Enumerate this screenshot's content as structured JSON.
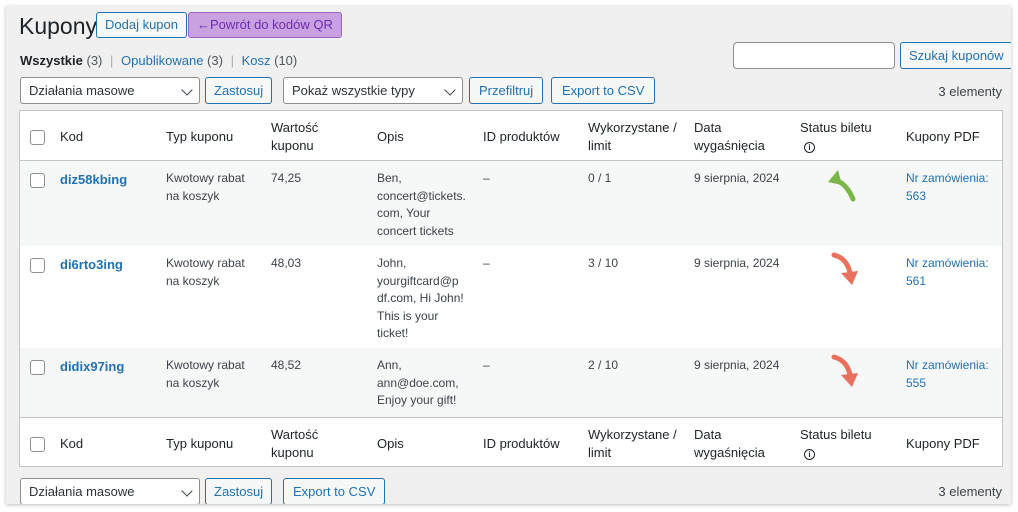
{
  "header": {
    "title": "Kupony",
    "add_button": "Dodaj kupon",
    "back_qr_button": "←Powrót do kodów QR"
  },
  "filters": {
    "all_label": "Wszystkie",
    "all_count": "(3)",
    "published_label": "Opublikowane",
    "published_count": "(3)",
    "trash_label": "Kosz",
    "trash_count": "(10)",
    "separator": "|"
  },
  "search": {
    "value": "",
    "button": "Szukaj kuponów"
  },
  "toolbar_top": {
    "bulk_actions": "Działania masowe",
    "apply": "Zastosuj",
    "type_filter": "Pokaż wszystkie typy",
    "filter_button": "Przefiltruj",
    "export_csv": "Export to CSV",
    "items_count": "3 elementy"
  },
  "toolbar_bottom": {
    "bulk_actions": "Działania masowe",
    "apply": "Zastosuj",
    "export_csv": "Export to CSV",
    "items_count": "3 elementy"
  },
  "columns": {
    "code": "Kod",
    "type": "Typ kuponu",
    "value_line1": "Wartość",
    "value_line2": "kuponu",
    "description": "Opis",
    "product_ids": "ID produktów",
    "usage_line1": "Wykorzystane /",
    "usage_line2": "limit",
    "expiry_line1": "Data",
    "expiry_line2": "wygaśnięcia",
    "ticket_status": "Status biletu",
    "ticket_status_icon": "info-icon",
    "pdf": "Kupony PDF"
  },
  "rows": [
    {
      "code": "diz58kbing",
      "type_line1": "Kwotowy rabat",
      "type_line2": "na koszyk",
      "value": "74,25",
      "desc_lines": [
        "Ben,",
        "concert@tickets.",
        "com, Your",
        "concert tickets"
      ],
      "product_ids": "–",
      "usage": "0 / 1",
      "expiry": "9 sierpnia, 2024",
      "status_icon": "arrow-up-green-icon",
      "status_color": "#7ab648",
      "pdf_line1": "Nr zamówienia:",
      "pdf_line2": "563"
    },
    {
      "code": "di6rto3ing",
      "type_line1": "Kwotowy rabat",
      "type_line2": "na koszyk",
      "value": "48,03",
      "desc_lines": [
        "John,",
        "yourgiftcard@p",
        "df.com, Hi John!",
        "This is your",
        "ticket!"
      ],
      "product_ids": "–",
      "usage": "3 / 10",
      "expiry": "9 sierpnia, 2024",
      "status_icon": "arrow-down-red-icon",
      "status_color": "#e8705c",
      "pdf_line1": "Nr zamówienia:",
      "pdf_line2": "561"
    },
    {
      "code": "didix97ing",
      "type_line1": "Kwotowy rabat",
      "type_line2": "na koszyk",
      "value": "48,52",
      "desc_lines": [
        "Ann,",
        "ann@doe.com,",
        "Enjoy your gift!"
      ],
      "product_ids": "–",
      "usage": "2 / 10",
      "expiry": "9 sierpnia, 2024",
      "status_icon": "arrow-down-red-icon",
      "status_color": "#e8705c",
      "pdf_line1": "Nr zamówienia:",
      "pdf_line2": "555"
    }
  ],
  "colors": {
    "accent": "#2271b1",
    "qr_button_bg": "#c9a0e0",
    "qr_button_text": "#6c2eb0"
  }
}
